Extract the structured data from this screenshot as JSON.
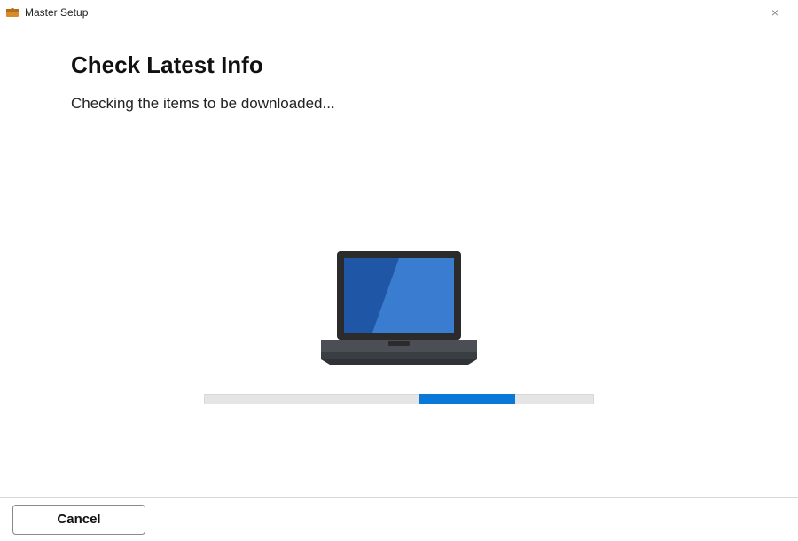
{
  "titlebar": {
    "title": "Master Setup",
    "close_glyph": "×"
  },
  "main": {
    "heading": "Check Latest Info",
    "status": "Checking the items to be downloaded..."
  },
  "progress": {
    "start_pct": 55,
    "width_pct": 25
  },
  "footer": {
    "cancel_label": "Cancel"
  },
  "colors": {
    "accent": "#0a78d6",
    "screen_dark": "#1f57a6",
    "screen_light": "#3a7cd0",
    "bezel": "#2b2b2b",
    "base_top": "#4b4f55",
    "base_bottom": "#3a3d42"
  }
}
